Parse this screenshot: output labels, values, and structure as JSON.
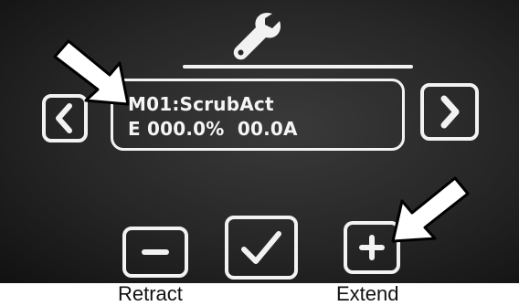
{
  "display": {
    "motor_name": "M01:ScrubAct",
    "status_line": "E 000.0%  00.0A"
  },
  "header": {
    "icon": "wrench-icon"
  },
  "controls": {
    "prev_icon": "chevron-left-icon",
    "next_icon": "chevron-right-icon",
    "retract_icon": "minus-icon",
    "confirm_icon": "checkmark-icon",
    "extend_icon": "plus-icon"
  },
  "captions": {
    "retract": "Retract",
    "extend": "Extend"
  },
  "annotations": {
    "arrow_icon": "pointer-arrow-icon"
  },
  "colors": {
    "screen_background": "#262626",
    "foreground": "#f2f2f2",
    "annotation": "#ffffff",
    "caption": "#111111"
  }
}
